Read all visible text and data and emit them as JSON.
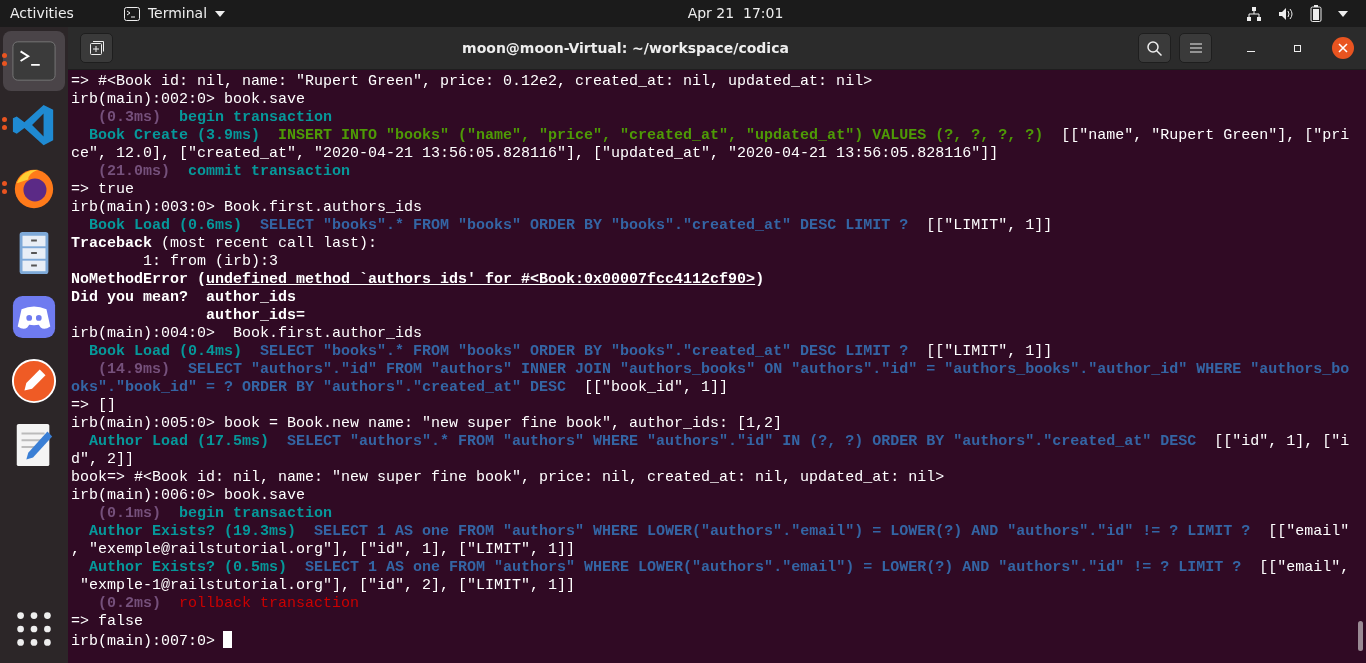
{
  "top_bar": {
    "activities": "Activities",
    "app_menu": "Terminal",
    "clock": "Apr 21  17:01"
  },
  "dock": [
    {
      "kind": "terminal",
      "running": true,
      "selected": true
    },
    {
      "kind": "ribbon",
      "running": true,
      "selected": false
    },
    {
      "kind": "globe",
      "running": true,
      "selected": false
    },
    {
      "kind": "cabinet",
      "running": false,
      "selected": false
    },
    {
      "kind": "controller",
      "running": false,
      "selected": false
    },
    {
      "kind": "pen",
      "running": false,
      "selected": false
    },
    {
      "kind": "notepad",
      "running": false,
      "selected": false
    },
    {
      "kind": "grid",
      "running": false,
      "selected": false
    }
  ],
  "window": {
    "title": "moon@moon-Virtual: ~/workspace/codica"
  },
  "terminal": {
    "cursor": true,
    "lines": [
      {
        "segments": [
          {
            "kind": "plain",
            "text": "=> #<Book id: nil, name: \"Rupert Green\", price: 0.12e2, created_at: nil, updated_at: nil>"
          }
        ]
      },
      {
        "segments": [
          {
            "kind": "plain",
            "text": "irb(main):002:0> book.save"
          }
        ]
      },
      {
        "segments": [
          {
            "kind": "muted",
            "text": "   (0.3ms)"
          },
          {
            "kind": "cyan",
            "text": "  begin transaction"
          }
        ]
      },
      {
        "segments": [
          {
            "kind": "cyan",
            "text": "  Book Create (3.9ms)"
          },
          {
            "kind": "green",
            "text": "  INSERT INTO \"books\" (\"name\", \"price\", \"created_at\", \"updated_at\") VALUES (?, ?, ?, ?)"
          },
          {
            "kind": "plain",
            "text": "  [[\"name\", \"Rupert Green\"], [\"pri"
          }
        ]
      },
      {
        "segments": [
          {
            "kind": "plain",
            "text": "ce\", 12.0], [\"created_at\", \"2020-04-21 13:56:05.828116\"], [\"updated_at\", \"2020-04-21 13:56:05.828116\"]]"
          }
        ]
      },
      {
        "segments": [
          {
            "kind": "muted",
            "text": "   (21.0ms)"
          },
          {
            "kind": "cyan",
            "text": "  commit transaction"
          }
        ]
      },
      {
        "segments": [
          {
            "kind": "plain",
            "text": "=> true"
          }
        ]
      },
      {
        "segments": [
          {
            "kind": "plain",
            "text": "irb(main):003:0> Book.first.authors_ids"
          }
        ]
      },
      {
        "segments": [
          {
            "kind": "cyan",
            "text": "  Book Load (0.6ms)"
          },
          {
            "kind": "blue",
            "text": "  SELECT \"books\".* FROM \"books\" ORDER BY \"books\".\"created_at\" DESC LIMIT ?"
          },
          {
            "kind": "plain",
            "text": "  [[\"LIMIT\", 1]]"
          }
        ]
      },
      {
        "segments": [
          {
            "kind": "bold",
            "text": "Traceback"
          },
          {
            "kind": "plain",
            "text": " (most recent call last):"
          }
        ]
      },
      {
        "segments": [
          {
            "kind": "plain",
            "text": "        1: from (irb):3"
          }
        ]
      },
      {
        "segments": [
          {
            "kind": "bold",
            "text": "NoMethodError ("
          },
          {
            "kind": "boldunder",
            "text": "undefined method `authors_ids' for #<Book:0x00007fcc4112cf90>"
          },
          {
            "kind": "bold",
            "text": ")"
          }
        ]
      },
      {
        "segments": [
          {
            "kind": "bold",
            "text": "Did you mean?  author_ids"
          }
        ]
      },
      {
        "segments": [
          {
            "kind": "bold",
            "text": "               author_ids="
          }
        ]
      },
      {
        "segments": [
          {
            "kind": "plain",
            "text": "irb(main):004:0>  Book.first.author_ids"
          }
        ]
      },
      {
        "segments": [
          {
            "kind": "cyan",
            "text": "  Book Load (0.4ms)"
          },
          {
            "kind": "blue",
            "text": "  SELECT \"books\".* FROM \"books\" ORDER BY \"books\".\"created_at\" DESC LIMIT ?"
          },
          {
            "kind": "plain",
            "text": "  [[\"LIMIT\", 1]]"
          }
        ]
      },
      {
        "segments": [
          {
            "kind": "muted",
            "text": "   (14.9ms)"
          },
          {
            "kind": "blue",
            "text": "  SELECT \"authors\".\"id\" FROM \"authors\" INNER JOIN \"authors_books\" ON \"authors\".\"id\" = \"authors_books\".\"author_id\" WHERE \"authors_bo"
          }
        ]
      },
      {
        "segments": [
          {
            "kind": "blue",
            "text": "oks\".\"book_id\" = ? ORDER BY \"authors\".\"created_at\" DESC"
          },
          {
            "kind": "plain",
            "text": "  [[\"book_id\", 1]]"
          }
        ]
      },
      {
        "segments": [
          {
            "kind": "plain",
            "text": "=> []"
          }
        ]
      },
      {
        "segments": [
          {
            "kind": "plain",
            "text": "irb(main):005:0> book = Book.new name: \"new super fine book\", author_ids: [1,2]"
          }
        ]
      },
      {
        "segments": [
          {
            "kind": "cyan",
            "text": "  Author Load (17.5ms)"
          },
          {
            "kind": "blue",
            "text": "  SELECT \"authors\".* FROM \"authors\" WHERE \"authors\".\"id\" IN (?, ?) ORDER BY \"authors\".\"created_at\" DESC"
          },
          {
            "kind": "plain",
            "text": "  [[\"id\", 1], [\"i"
          }
        ]
      },
      {
        "segments": [
          {
            "kind": "plain",
            "text": "d\", 2]]"
          }
        ]
      },
      {
        "segments": [
          {
            "kind": "plain",
            "text": "book=> #<Book id: nil, name: \"new super fine book\", price: nil, created_at: nil, updated_at: nil>"
          }
        ]
      },
      {
        "segments": [
          {
            "kind": "plain",
            "text": "irb(main):006:0> book.save"
          }
        ]
      },
      {
        "segments": [
          {
            "kind": "muted",
            "text": "   (0.1ms)"
          },
          {
            "kind": "cyan",
            "text": "  begin transaction"
          }
        ]
      },
      {
        "segments": [
          {
            "kind": "cyan",
            "text": "  Author Exists? (19.3ms)"
          },
          {
            "kind": "blue",
            "text": "  SELECT 1 AS one FROM \"authors\" WHERE LOWER(\"authors\".\"email\") = LOWER(?) AND \"authors\".\"id\" != ? LIMIT ?"
          },
          {
            "kind": "plain",
            "text": "  [[\"email\""
          }
        ]
      },
      {
        "segments": [
          {
            "kind": "plain",
            "text": ", \"exemple@railstutorial.org\"], [\"id\", 1], [\"LIMIT\", 1]]"
          }
        ]
      },
      {
        "segments": [
          {
            "kind": "cyan",
            "text": "  Author Exists? (0.5ms)"
          },
          {
            "kind": "blue",
            "text": "  SELECT 1 AS one FROM \"authors\" WHERE LOWER(\"authors\".\"email\") = LOWER(?) AND \"authors\".\"id\" != ? LIMIT ?"
          },
          {
            "kind": "plain",
            "text": "  [[\"email\","
          }
        ]
      },
      {
        "segments": [
          {
            "kind": "plain",
            "text": " \"exmple-1@railstutorial.org\"], [\"id\", 2], [\"LIMIT\", 1]]"
          }
        ]
      },
      {
        "segments": [
          {
            "kind": "muted",
            "text": "   (0.2ms)"
          },
          {
            "kind": "red",
            "text": "  rollback transaction"
          }
        ]
      },
      {
        "segments": [
          {
            "kind": "plain",
            "text": "=> false"
          }
        ]
      },
      {
        "segments": [
          {
            "kind": "plain",
            "text": "irb(main):007:0>"
          }
        ]
      }
    ]
  }
}
